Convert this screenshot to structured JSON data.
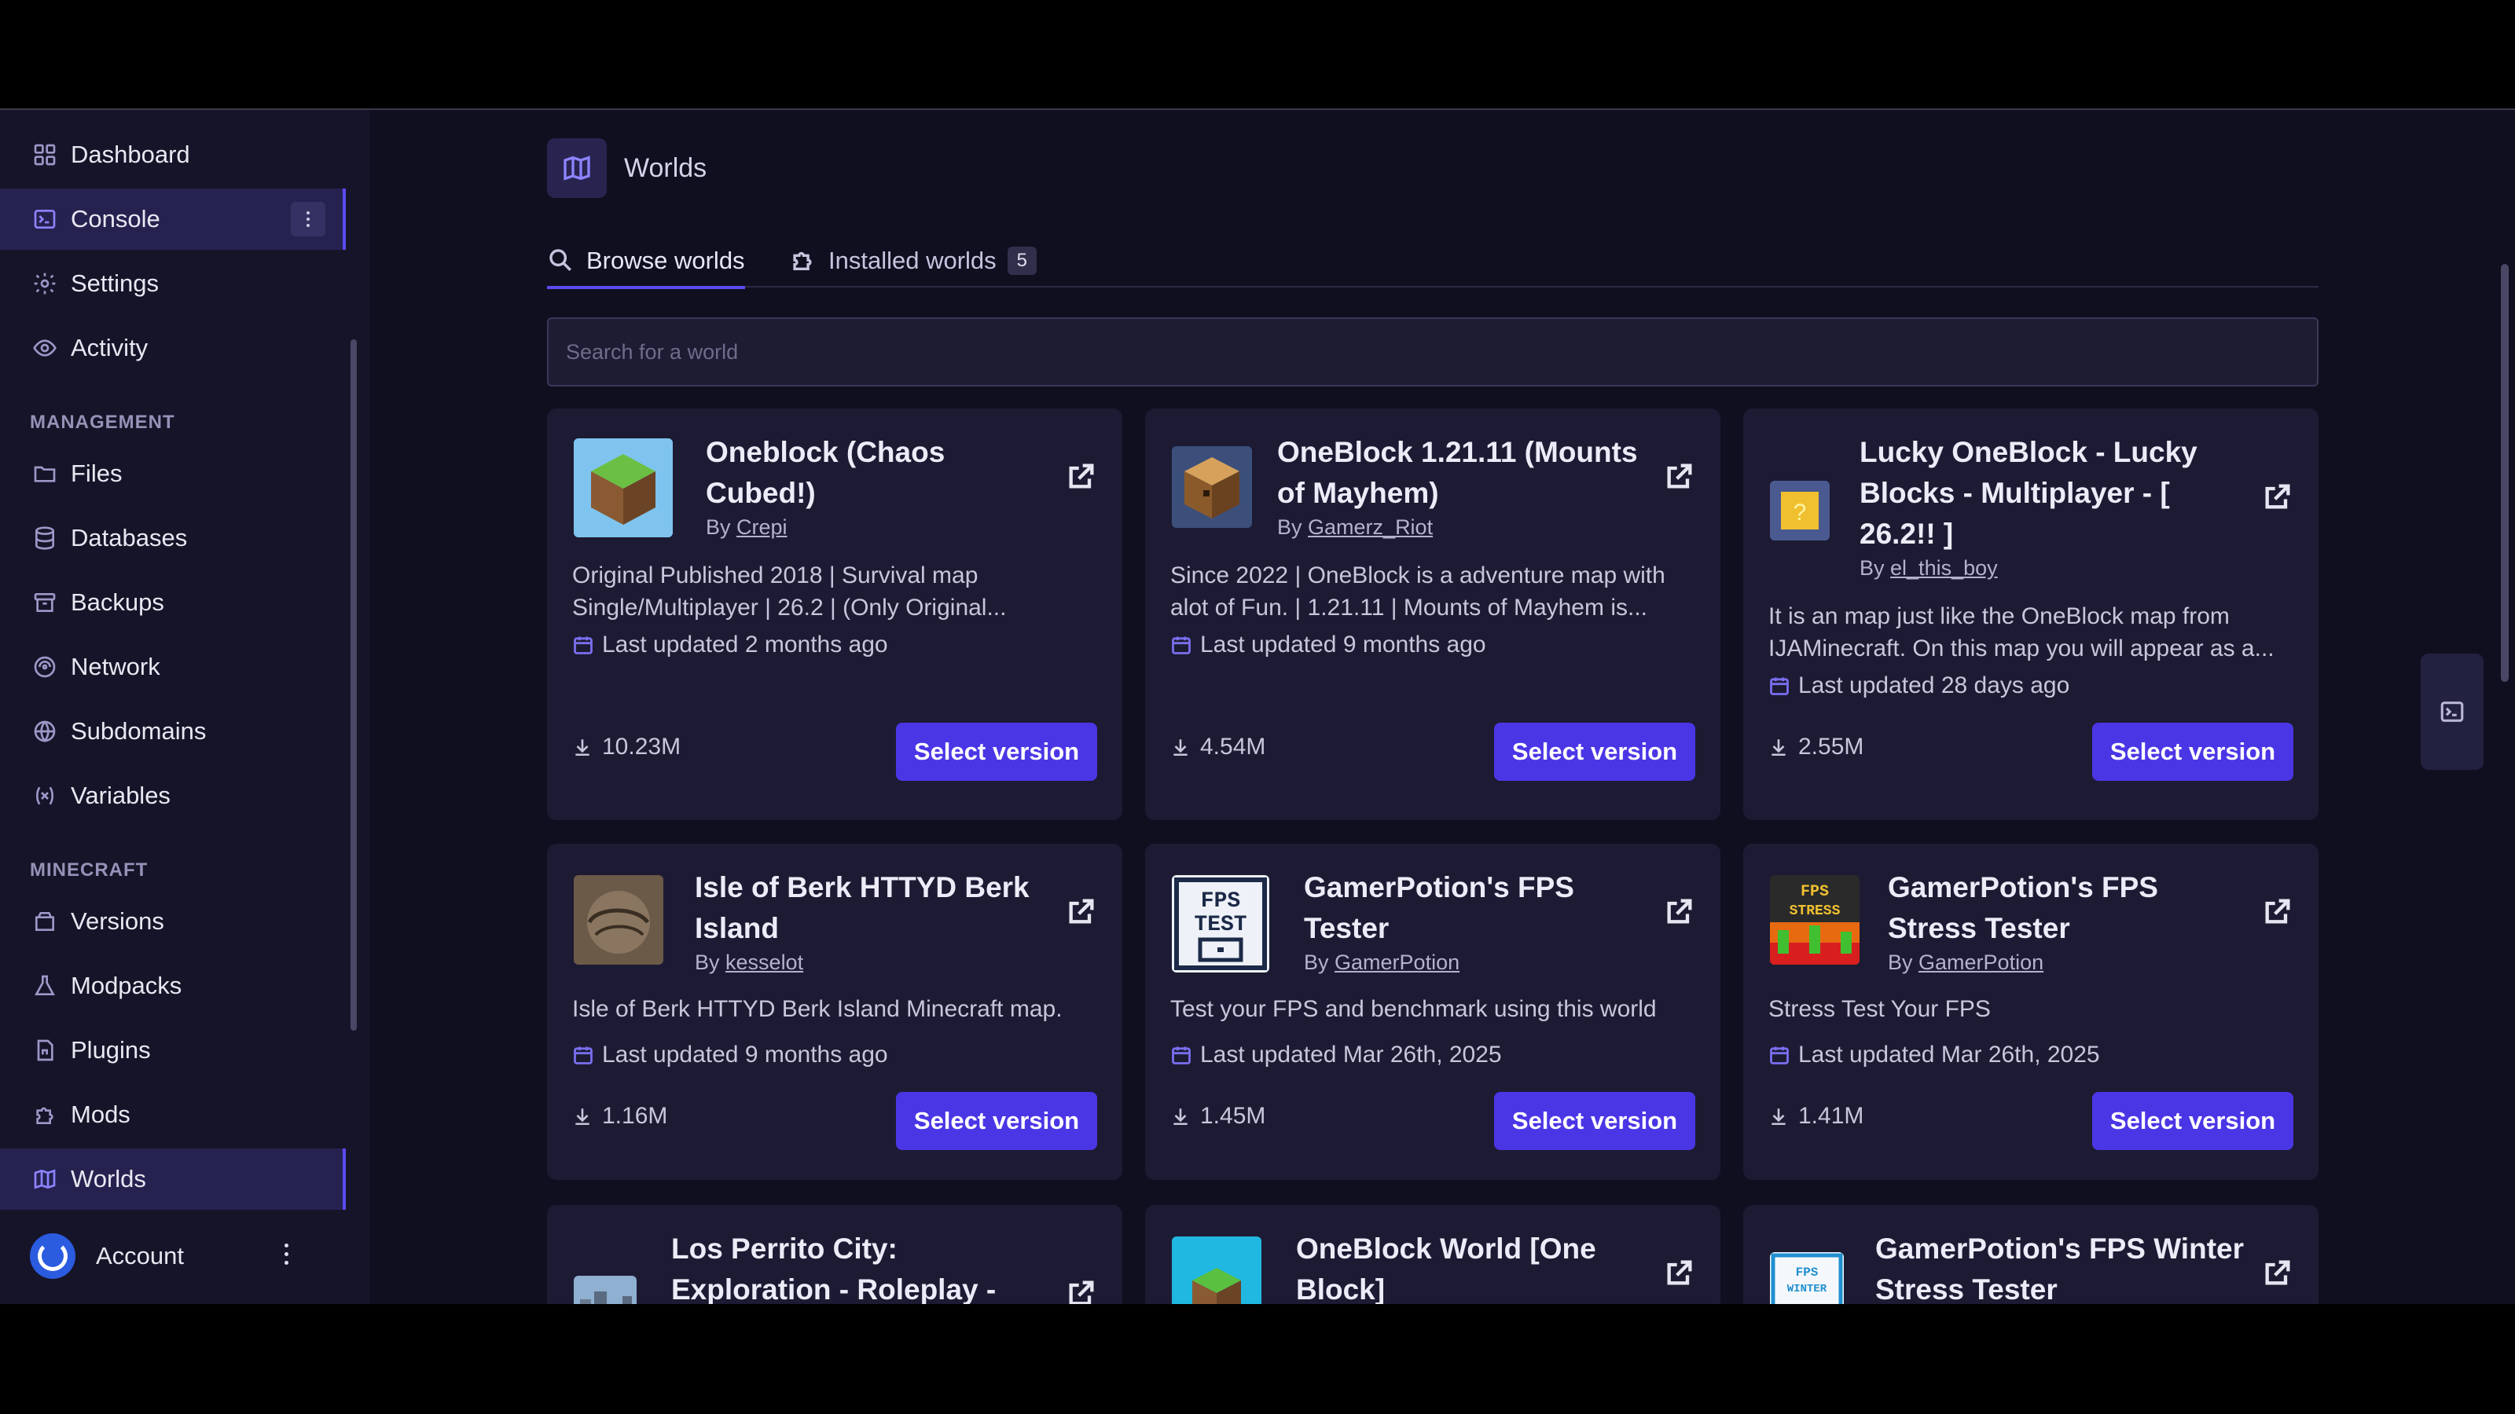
{
  "sidebar": {
    "items": [
      {
        "label": "Dashboard",
        "icon": "grid-icon"
      },
      {
        "label": "Console",
        "icon": "terminal-icon",
        "active": true
      },
      {
        "label": "Settings",
        "icon": "gear-icon"
      },
      {
        "label": "Activity",
        "icon": "eye-icon"
      }
    ],
    "management_label": "MANAGEMENT",
    "management_items": [
      {
        "label": "Files",
        "icon": "folder-icon"
      },
      {
        "label": "Databases",
        "icon": "database-icon"
      },
      {
        "label": "Backups",
        "icon": "archive-icon"
      },
      {
        "label": "Network",
        "icon": "network-icon"
      },
      {
        "label": "Subdomains",
        "icon": "globe-icon"
      },
      {
        "label": "Variables",
        "icon": "variable-icon"
      }
    ],
    "minecraft_label": "MINECRAFT",
    "minecraft_items": [
      {
        "label": "Versions",
        "icon": "box-icon"
      },
      {
        "label": "Modpacks",
        "icon": "flask-icon"
      },
      {
        "label": "Plugins",
        "icon": "plugin-icon"
      },
      {
        "label": "Mods",
        "icon": "puzzle-icon"
      },
      {
        "label": "Worlds",
        "icon": "map-icon",
        "active": true
      }
    ],
    "account_label": "Account"
  },
  "header": {
    "title": "Worlds"
  },
  "tabs": {
    "browse": "Browse worlds",
    "installed": "Installed worlds",
    "installed_count": "5"
  },
  "search": {
    "placeholder": "Search for a world"
  },
  "cards": [
    {
      "title": "Oneblock (Chaos Cubed!)",
      "by": "By",
      "author": "Crepi",
      "desc": "Original Published 2018 | Survival map Single/Multiplayer | 26.2 | (Only Original...",
      "updated": "Last updated 2 months ago",
      "downloads": "10.23M",
      "button": "Select version"
    },
    {
      "title": "OneBlock 1.21.11 (Mounts of Mayhem)",
      "by": "By",
      "author": "Gamerz_Riot",
      "desc": "Since 2022 | OneBlock is a adventure map with alot of Fun. | 1.21.11 | Mounts of Mayhem is...",
      "updated": "Last updated 9 months ago",
      "downloads": "4.54M",
      "button": "Select version"
    },
    {
      "title": "Lucky OneBlock - Lucky Blocks - Multiplayer - [ 26.2!! ]",
      "by": "By",
      "author": "el_this_boy",
      "desc": "It is an map just like the OneBlock map from IJAMinecraft. On this map you will appear as a...",
      "updated": "Last updated 28 days ago",
      "downloads": "2.55M",
      "button": "Select version"
    },
    {
      "title": "Isle of Berk HTTYD Berk Island",
      "by": "By",
      "author": "kesselot",
      "desc": "Isle of Berk HTTYD Berk Island Minecraft map.",
      "updated": "Last updated 9 months ago",
      "downloads": "1.16M",
      "button": "Select version"
    },
    {
      "title": "GamerPotion's FPS Tester",
      "by": "By",
      "author": "GamerPotion",
      "desc": "Test your FPS and benchmark using this world",
      "updated": "Last updated Mar 26th, 2025",
      "downloads": "1.45M",
      "button": "Select version"
    },
    {
      "title": "GamerPotion's FPS Stress Tester",
      "by": "By",
      "author": "GamerPotion",
      "desc": "Stress Test Your FPS",
      "updated": "Last updated Mar 26th, 2025",
      "downloads": "1.41M",
      "button": "Select version"
    },
    {
      "title": "Los Perrito City: Exploration - Roleplay -"
    },
    {
      "title": "OneBlock World [One Block]"
    },
    {
      "title": "GamerPotion's FPS Winter Stress Tester"
    }
  ],
  "colors": {
    "accent": "#4b36e6",
    "background": "#100f20",
    "card": "#1d1b33",
    "sidebar": "#161429"
  }
}
